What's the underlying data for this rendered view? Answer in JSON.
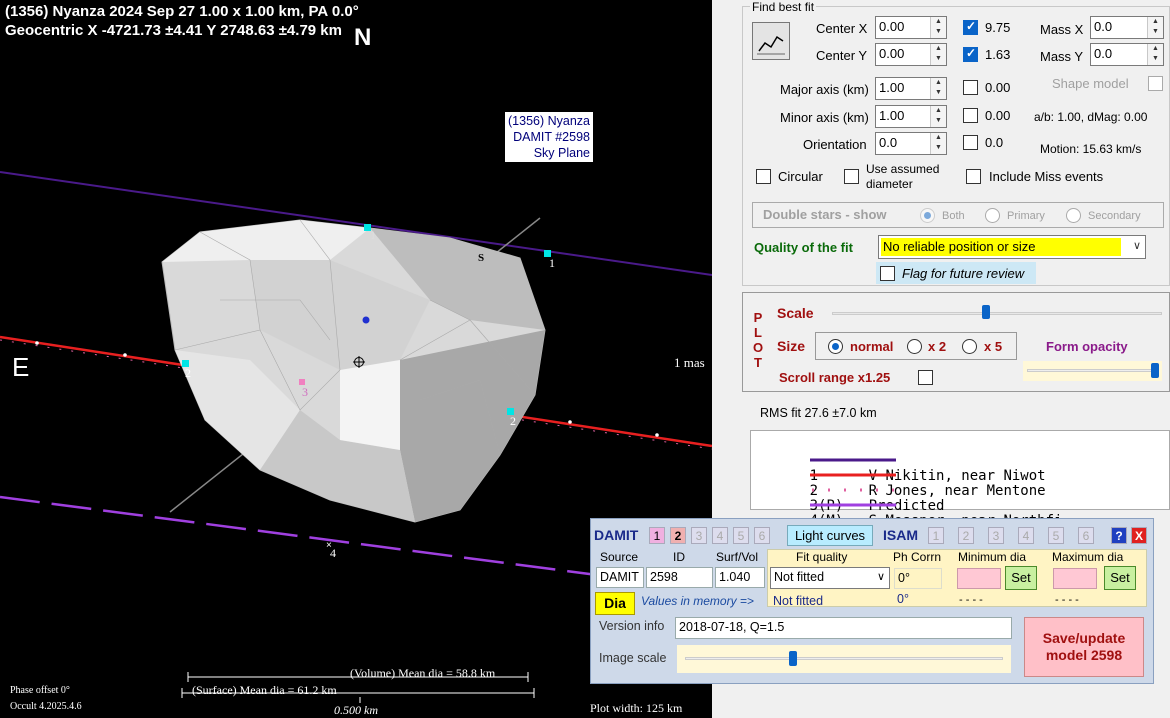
{
  "plot": {
    "header_line1": "(1356) Nyanza  2024 Sep 27   1.00 x 1.00 km,  PA 0.0°",
    "header_line2": "Geocentric  X  -4721.73 ±4.41  Y 2748.63 ±4.79 km",
    "north": "N",
    "east": "E",
    "sky_label_1": "(1356) Nyanza",
    "sky_label_2": "DAMIT #2598",
    "sky_label_3": "Sky Plane",
    "south_marker": "S",
    "scale_mas": "1 mas",
    "volume_dia": "(Volume) Mean dia = 58.8 km",
    "surface_dia": "(Surface) Mean dia = 61.2 km",
    "scale_bar": "0.500 km",
    "phase_offset": "Phase offset 0°",
    "version": "Occult 4.2025.4.6",
    "plot_width": "Plot width: 125 km",
    "chord_labels": [
      "1",
      "1",
      "2",
      "2",
      "3",
      "4"
    ]
  },
  "fit": {
    "title": "Find best fit",
    "center_x_label": "Center X",
    "center_x": "0.00",
    "center_y_label": "Center Y",
    "center_y": "0.00",
    "cx_check": "9.75",
    "cy_check": "1.63",
    "mass_x_label": "Mass X",
    "mass_x": "0.0",
    "mass_y_label": "Mass Y",
    "mass_y": "0.0",
    "major_label": "Major axis (km)",
    "major": "1.00",
    "major_check": "0.00",
    "minor_label": "Minor axis (km)",
    "minor": "1.00",
    "minor_check": "0.00",
    "orient_label": "Orientation",
    "orient": "0.0",
    "orient_check": "0.0",
    "shape_model": "Shape model",
    "ab_dmag": "a/b: 1.00, dMag: 0.00",
    "motion": "Motion: 15.63 km/s",
    "circular": "Circular",
    "assumed_dia_1": "Use assumed",
    "assumed_dia_2": "diameter",
    "include_miss": "Include Miss events",
    "double_stars": "Double stars - show",
    "both": "Both",
    "primary": "Primary",
    "secondary": "Secondary",
    "quality_label": "Quality of the fit",
    "quality_value": "No reliable position or size",
    "flag_review": "Flag for future review"
  },
  "plotctl": {
    "plot_letters": [
      "P",
      "L",
      "O",
      "T"
    ],
    "scale": "Scale",
    "size": "Size",
    "normal": "normal",
    "x2": "x 2",
    "x5": "x 5",
    "form_opacity": "Form opacity",
    "scroll_range": "Scroll range x1.25",
    "rms": "RMS fit 27.6 ±7.0 km"
  },
  "legend": [
    {
      "num": "1   ",
      "name": "V Nikitin, near Niwot",
      "color": "#4a1a8a"
    },
    {
      "num": "2   ",
      "name": "R Jones, near Mentone",
      "color": "#e82020"
    },
    {
      "num": "3(P)",
      "name": "Predicted",
      "color": "#e060a0"
    },
    {
      "num": "4(M)",
      "name": "S Messner, near Northfi",
      "color": "#a040e0"
    }
  ],
  "damit": {
    "title": "DAMIT",
    "nums": [
      "1",
      "2",
      "3",
      "4",
      "5",
      "6"
    ],
    "light_curves": "Light curves",
    "isam": "ISAM",
    "isam_nums": [
      "1",
      "2",
      "3",
      "4",
      "5",
      "6"
    ],
    "help": "?",
    "close": "X",
    "source_h": "Source",
    "id_h": "ID",
    "surf_h": "Surf/Vol",
    "fitq_h": "Fit quality",
    "phcorr_h": "Ph Corrn",
    "mindia_h": "Minimum dia",
    "maxdia_h": "Maximum dia",
    "source": "DAMIT",
    "id": "2598",
    "surf": "1.040",
    "fitq": "Not fitted",
    "phcorr": "0°",
    "set": "Set",
    "dia_btn": "Dia",
    "values_mem": "Values in memory =>",
    "fitq_mem": "Not fitted",
    "phcorr_mem": "0°",
    "min_mem": "- - - -",
    "max_mem": "- - - -",
    "version_label": "Version info",
    "version": "2018-07-18, Q=1.5",
    "image_scale": "Image scale",
    "save_1": "Save/update",
    "save_2": "model 2598"
  }
}
